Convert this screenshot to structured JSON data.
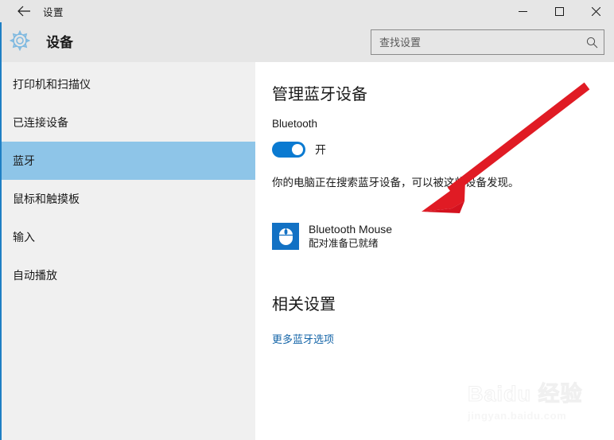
{
  "window": {
    "title": "设置",
    "back_icon": "back-arrow-icon",
    "controls": {
      "minimize": "minimize-icon",
      "maximize": "maximize-icon",
      "close": "close-icon"
    }
  },
  "header": {
    "icon": "gear-icon",
    "title": "设备",
    "search": {
      "placeholder": "查找设置",
      "value": "",
      "icon": "search-icon"
    }
  },
  "sidebar": {
    "selected_index": 2,
    "items": [
      {
        "label": "打印机和扫描仪",
        "name": "sidebar-item-printers-scanners"
      },
      {
        "label": "已连接设备",
        "name": "sidebar-item-connected-devices"
      },
      {
        "label": "蓝牙",
        "name": "sidebar-item-bluetooth"
      },
      {
        "label": "鼠标和触摸板",
        "name": "sidebar-item-mouse-touchpad"
      },
      {
        "label": "输入",
        "name": "sidebar-item-typing"
      },
      {
        "label": "自动播放",
        "name": "sidebar-item-autoplay"
      }
    ]
  },
  "main": {
    "heading": "管理蓝牙设备",
    "bluetooth_label": "Bluetooth",
    "toggle": {
      "state_label": "开",
      "on": true
    },
    "description": "你的电脑正在搜索蓝牙设备，可以被这些设备发现。",
    "devices": [
      {
        "icon": "mouse-icon",
        "name": "Bluetooth Mouse",
        "status": "配对准备已就绪"
      }
    ],
    "related_heading": "相关设置",
    "related_link": "更多蓝牙选项"
  },
  "annotation": {
    "type": "arrow",
    "color": "#e01b24",
    "points_at": "Bluetooth Mouse"
  },
  "watermark": {
    "main": "Baidu 经验",
    "sub": "jingyan.baidu.com"
  },
  "colors": {
    "accent": "#0a7ad1",
    "selection": "#8ec5e8",
    "sidebar_bg": "#f0f0f0",
    "titlebar_bg": "#e6e6e6",
    "link": "#1565a8",
    "annotation": "#e01b24"
  }
}
